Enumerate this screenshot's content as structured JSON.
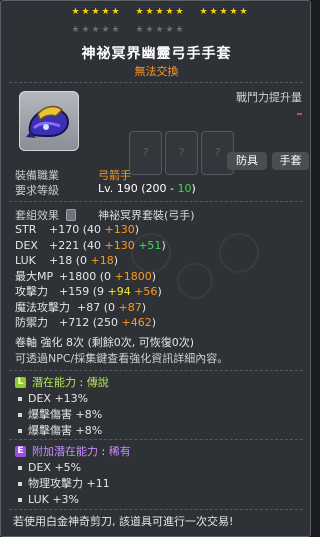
{
  "item": {
    "name": "神祕冥界幽靈弓手手套",
    "trade_status": "無法交換",
    "icon": "glove-icon",
    "star_force": {
      "total": 25,
      "filled": 15
    }
  },
  "combat_power": {
    "label": "戰鬥力提升量",
    "value": "-"
  },
  "job_cards": [
    "?",
    "?",
    "?"
  ],
  "equip_tags": [
    "防具",
    "手套"
  ],
  "requirements": {
    "job_label": "裝備職業",
    "job_value": "弓箭手",
    "level_label": "要求等級",
    "level_prefix": "Lv. 190 (",
    "level_base": "200",
    "level_sep": " - ",
    "level_reduction": "10",
    "level_suffix": ")"
  },
  "set": {
    "label": "套組效果",
    "name": "神祕冥界套裝(弓手)"
  },
  "stats": [
    {
      "name": "STR",
      "total": "+170",
      "base": "40",
      "scroll": "",
      "star": "+130",
      "extra": ""
    },
    {
      "name": "DEX",
      "total": "+221",
      "base": "40",
      "scroll": "",
      "star": "+130",
      "extra": "+51"
    },
    {
      "name": "LUK",
      "total": "+18",
      "base": "0",
      "scroll": "",
      "star": "+18",
      "extra": ""
    },
    {
      "name": "最大MP",
      "total": "+1800",
      "base": "0",
      "scroll": "",
      "star": "+1800",
      "extra": ""
    },
    {
      "name": "攻擊力",
      "total": "+159",
      "base": "9",
      "scroll": "+94",
      "star": "+56",
      "extra": ""
    },
    {
      "name": "魔法攻擊力",
      "total": "+87",
      "base": "0",
      "scroll": "",
      "star": "+87",
      "extra": ""
    },
    {
      "name": "防禦力",
      "total": "+712",
      "base": "250",
      "scroll": "",
      "star": "+462",
      "extra": ""
    }
  ],
  "upgrade": {
    "line": "卷軸 強化 8次 (剩餘0次, 可恢復0次)",
    "hint": "可透過NPC/採集鍵查看強化資訊詳細內容。"
  },
  "potential": {
    "badge": "L",
    "title": "潛在能力",
    "sep": " : ",
    "grade": "傳說",
    "lines": [
      "DEX +13%",
      "爆擊傷害 +8%",
      "爆擊傷害 +8%"
    ]
  },
  "bonus_potential": {
    "badge": "E",
    "title": "附加潛在能力",
    "sep": " : ",
    "grade": "稀有",
    "lines": [
      "DEX +5%",
      "物理攻擊力 +11",
      "LUK +3%"
    ]
  },
  "footer": "若使用白金神奇剪刀, 該道具可進行一次交易!",
  "colors": {
    "star_filled": "#f2d21a",
    "star_empty": "#6b6f76",
    "legendary": "#8ecb2e",
    "epic": "#9b4fe0"
  }
}
